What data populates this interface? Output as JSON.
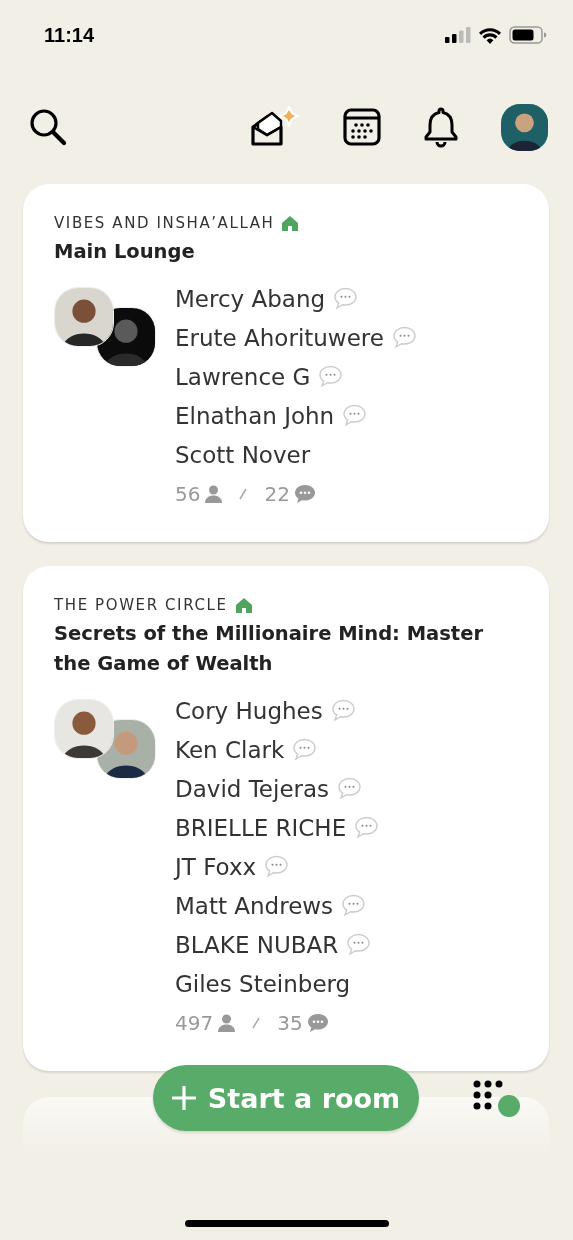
{
  "status_bar": {
    "time": "11:14"
  },
  "top_bar": {
    "invites_new": true
  },
  "rooms": [
    {
      "club": "VIBES AND INSHA’ALLAH",
      "club_home": true,
      "title": "Main Lounge",
      "speakers": [
        {
          "name": "Mercy Abang",
          "chat": true
        },
        {
          "name": "Erute Ahorituwere",
          "chat": true
        },
        {
          "name": "Lawrence G",
          "chat": true
        },
        {
          "name": "Elnathan John",
          "chat": true
        },
        {
          "name": "Scott Nover",
          "chat": false
        }
      ],
      "listeners": "56",
      "messages": "22"
    },
    {
      "club": "THE POWER CIRCLE",
      "club_home": true,
      "title": "Secrets of the Millionaire Mind: Master the Game of Wealth",
      "speakers": [
        {
          "name": "Cory Hughes",
          "chat": true
        },
        {
          "name": "Ken Clark",
          "chat": true
        },
        {
          "name": "David Tejeras",
          "chat": true
        },
        {
          "name": "BRIELLE RICHE",
          "chat": true
        },
        {
          "name": "JT Foxx",
          "chat": true
        },
        {
          "name": "Matt Andrews",
          "chat": true
        },
        {
          "name": "BLAKE NUBAR",
          "chat": true
        },
        {
          "name": "Giles Steinberg",
          "chat": false
        }
      ],
      "listeners": "497",
      "messages": "35"
    }
  ],
  "start_button": {
    "label": "Start a room"
  },
  "online_indicator": true
}
